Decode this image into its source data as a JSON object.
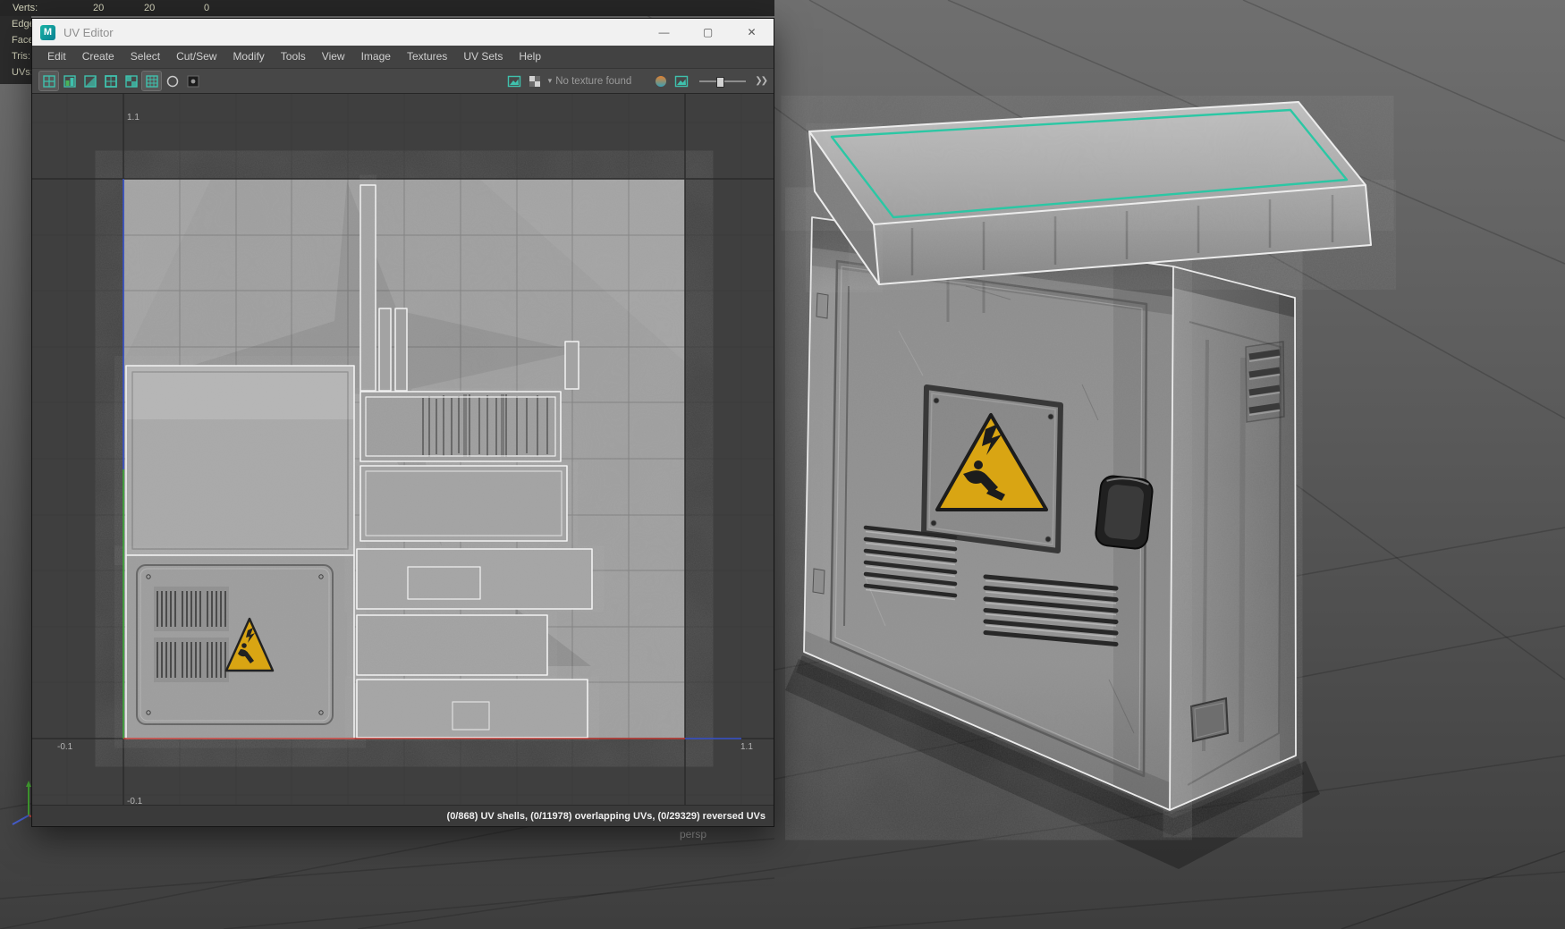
{
  "hud": {
    "verts_label": "Verts:",
    "verts_values": [
      "20",
      "20",
      "0"
    ],
    "rows": [
      {
        "label": "Edges:"
      },
      {
        "label": "Faces:"
      },
      {
        "label": "Tris:"
      },
      {
        "label": "UVs:"
      }
    ]
  },
  "window": {
    "title": "UV Editor",
    "logo_letter": "M",
    "controls": {
      "minimize": "—",
      "maximize": "▢",
      "close": "✕"
    },
    "menus": [
      {
        "label": "Edit"
      },
      {
        "label": "Create"
      },
      {
        "label": "Select"
      },
      {
        "label": "Cut/Sew"
      },
      {
        "label": "Modify"
      },
      {
        "label": "Tools"
      },
      {
        "label": "View"
      },
      {
        "label": "Image"
      },
      {
        "label": "Textures"
      },
      {
        "label": "UV Sets"
      },
      {
        "label": "Help"
      }
    ],
    "toolbar": {
      "texture_value": "No texture found",
      "dropdown_arrow": "▾",
      "chevrons": "❯❯"
    },
    "canvas": {
      "labels": {
        "top": "1.1",
        "bottom_left": "-0.1",
        "bottom_right": "1.1",
        "below_left": "-0.1"
      }
    },
    "status": "(0/868) UV shells, (0/11978) overlapping UVs, (0/29329) reversed UVs"
  },
  "viewport": {
    "camera_label": "persp",
    "axis_y": "y"
  },
  "colors": {
    "maya_teal": "#19b3a4",
    "selection_teal": "#2bc7a4",
    "warning_yellow": "#d9a513",
    "axis_red": "#c23b35",
    "axis_green": "#3fae3a",
    "axis_blue": "#3a55d0",
    "titlebar_bg": "#f1f1f1",
    "panel_dark": "#424242"
  }
}
